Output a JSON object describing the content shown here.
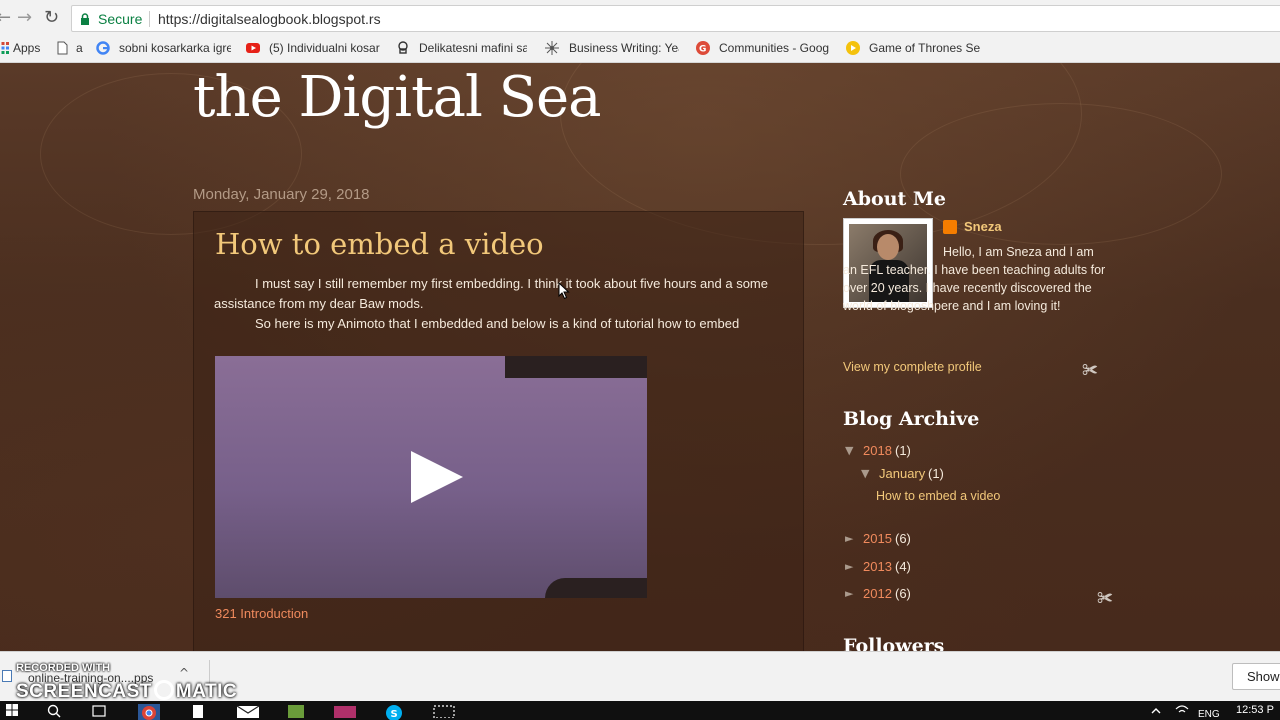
{
  "browser": {
    "secure_label": "Secure",
    "url": "https://digitalsealogbook.blogspot.rs",
    "bookmarks": [
      {
        "label": "Apps",
        "icon": "apps-grid-icon"
      },
      {
        "label": "a",
        "icon": "page-icon"
      },
      {
        "label": "sobni kosarkarka igre",
        "icon": "google-icon"
      },
      {
        "label": "(5) Individualni kosar",
        "icon": "youtube-icon"
      },
      {
        "label": "Delikatesni mafini sa",
        "icon": "chef-icon"
      },
      {
        "label": "Business Writing: Yea",
        "icon": "network-icon"
      },
      {
        "label": "Communities - Goog",
        "icon": "google-plus-icon"
      },
      {
        "label": "Game of Thrones Se",
        "icon": "bookmark-yellow-icon"
      }
    ]
  },
  "blog": {
    "title": "the Digital Sea",
    "date_header": "Monday, January 29, 2018",
    "post": {
      "title": "How to embed a video",
      "paragraph1": "I must say I still remember my first embedding. I think it took about five hours and a some assistance from my dear Baw mods.",
      "paragraph2": "So here is my Animoto that I embedded and below is a kind of tutorial how to embed",
      "video_caption": "321 Introduction"
    }
  },
  "sidebar": {
    "about_heading": "About Me",
    "profile_name": "Sneza",
    "about_text": "Hello, I am Sneza and I am an EFL teacher. I have been teaching adults for over 20 years. I have recently discovered the world of blogoshpere and I am loving it!",
    "profile_link": "View my complete profile",
    "archive_heading": "Blog Archive",
    "archive": [
      {
        "toggle": "▼",
        "year": "2018",
        "count": "(1)"
      },
      {
        "toggle": "▼",
        "month": "January",
        "count": "(1)",
        "post": "How to embed a video"
      },
      {
        "toggle": "►",
        "year": "2015",
        "count": "(6)"
      },
      {
        "toggle": "►",
        "year": "2013",
        "count": "(4)"
      },
      {
        "toggle": "►",
        "year": "2012",
        "count": "(6)"
      }
    ],
    "followers_heading": "Followers"
  },
  "downloads": {
    "file_name": "online-training-on....pps",
    "show_all": "Show",
    "watermark_top": "RECORDED WITH",
    "watermark_left": "SCREENCAST",
    "watermark_right": "MATIC"
  },
  "taskbar": {
    "language": "ENG",
    "time": "12:53 P"
  },
  "colors": {
    "accent_gold": "#f2c87a",
    "accent_orange": "#f08a5d",
    "page_bg": "#4a2e1f"
  }
}
